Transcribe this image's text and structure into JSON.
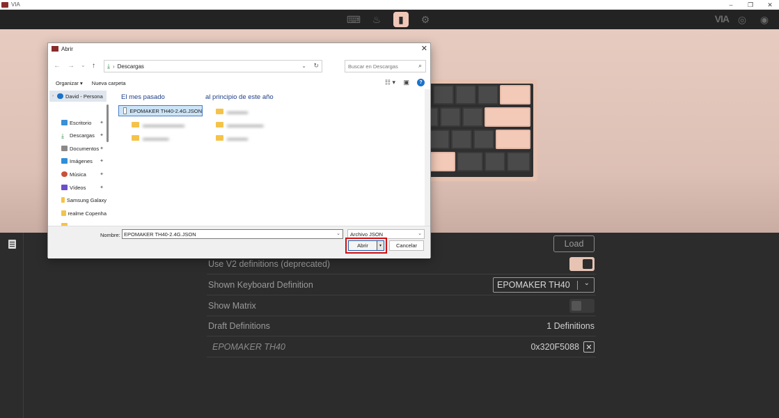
{
  "window": {
    "title": "VIA"
  },
  "via": {
    "logo": "VIA",
    "load_label": "Load",
    "rows": {
      "v2_label": "Use V2 definitions (deprecated)",
      "shown_def_label": "Shown Keyboard Definition",
      "shown_def_value": "EPOMAKER TH40",
      "matrix_label": "Show Matrix",
      "draft_label": "Draft Definitions",
      "draft_count": "1 Definitions",
      "def_name": "EPOMAKER TH40",
      "def_id": "0x320F5088"
    },
    "colors": {
      "accent": "#f0c8b7",
      "background": "#2c2c2c"
    }
  },
  "dialog": {
    "title": "Abrir",
    "breadcrumb": "Descargas",
    "search_placeholder": "Buscar en Descargas",
    "organize": "Organizar ▾",
    "new_folder": "Nueva carpeta",
    "nav": [
      {
        "label": "David - Persona",
        "icon": "cloud-icon"
      },
      {
        "label": "Escritorio",
        "icon": "desktop-icon"
      },
      {
        "label": "Descargas",
        "icon": "download-icon"
      },
      {
        "label": "Documentos",
        "icon": "documents-icon"
      },
      {
        "label": "Imágenes",
        "icon": "pictures-icon"
      },
      {
        "label": "Música",
        "icon": "music-icon"
      },
      {
        "label": "Vídeos",
        "icon": "videos-icon"
      },
      {
        "label": "Samsung Galaxy",
        "icon": "folder-icon"
      },
      {
        "label": "realme Copenha",
        "icon": "folder-icon"
      }
    ],
    "groups": {
      "last_month": "El mes pasado",
      "earlier_year": "al principio de este año"
    },
    "files": {
      "selected": "EPOMAKER TH40-2.4G.JSON"
    },
    "name_label": "Nombre:",
    "name_value": "EPOMAKER TH40-2.4G.JSON",
    "file_type": "Archivo JSON",
    "open_label": "Abrir",
    "cancel_label": "Cancelar"
  }
}
